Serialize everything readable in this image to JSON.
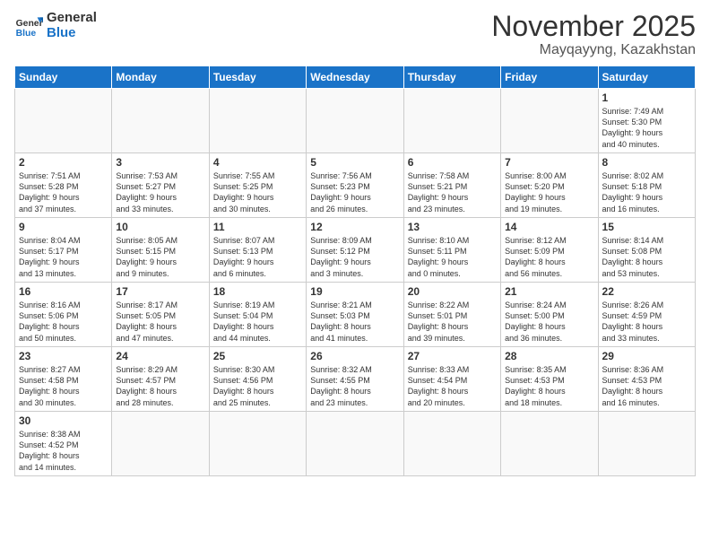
{
  "header": {
    "logo_general": "General",
    "logo_blue": "Blue",
    "title": "November 2025",
    "subtitle": "Mayqayyng, Kazakhstan"
  },
  "days_of_week": [
    "Sunday",
    "Monday",
    "Tuesday",
    "Wednesday",
    "Thursday",
    "Friday",
    "Saturday"
  ],
  "weeks": [
    [
      {
        "day": "",
        "info": ""
      },
      {
        "day": "",
        "info": ""
      },
      {
        "day": "",
        "info": ""
      },
      {
        "day": "",
        "info": ""
      },
      {
        "day": "",
        "info": ""
      },
      {
        "day": "",
        "info": ""
      },
      {
        "day": "1",
        "info": "Sunrise: 7:49 AM\nSunset: 5:30 PM\nDaylight: 9 hours\nand 40 minutes."
      }
    ],
    [
      {
        "day": "2",
        "info": "Sunrise: 7:51 AM\nSunset: 5:28 PM\nDaylight: 9 hours\nand 37 minutes."
      },
      {
        "day": "3",
        "info": "Sunrise: 7:53 AM\nSunset: 5:27 PM\nDaylight: 9 hours\nand 33 minutes."
      },
      {
        "day": "4",
        "info": "Sunrise: 7:55 AM\nSunset: 5:25 PM\nDaylight: 9 hours\nand 30 minutes."
      },
      {
        "day": "5",
        "info": "Sunrise: 7:56 AM\nSunset: 5:23 PM\nDaylight: 9 hours\nand 26 minutes."
      },
      {
        "day": "6",
        "info": "Sunrise: 7:58 AM\nSunset: 5:21 PM\nDaylight: 9 hours\nand 23 minutes."
      },
      {
        "day": "7",
        "info": "Sunrise: 8:00 AM\nSunset: 5:20 PM\nDaylight: 9 hours\nand 19 minutes."
      },
      {
        "day": "8",
        "info": "Sunrise: 8:02 AM\nSunset: 5:18 PM\nDaylight: 9 hours\nand 16 minutes."
      }
    ],
    [
      {
        "day": "9",
        "info": "Sunrise: 8:04 AM\nSunset: 5:17 PM\nDaylight: 9 hours\nand 13 minutes."
      },
      {
        "day": "10",
        "info": "Sunrise: 8:05 AM\nSunset: 5:15 PM\nDaylight: 9 hours\nand 9 minutes."
      },
      {
        "day": "11",
        "info": "Sunrise: 8:07 AM\nSunset: 5:13 PM\nDaylight: 9 hours\nand 6 minutes."
      },
      {
        "day": "12",
        "info": "Sunrise: 8:09 AM\nSunset: 5:12 PM\nDaylight: 9 hours\nand 3 minutes."
      },
      {
        "day": "13",
        "info": "Sunrise: 8:10 AM\nSunset: 5:11 PM\nDaylight: 9 hours\nand 0 minutes."
      },
      {
        "day": "14",
        "info": "Sunrise: 8:12 AM\nSunset: 5:09 PM\nDaylight: 8 hours\nand 56 minutes."
      },
      {
        "day": "15",
        "info": "Sunrise: 8:14 AM\nSunset: 5:08 PM\nDaylight: 8 hours\nand 53 minutes."
      }
    ],
    [
      {
        "day": "16",
        "info": "Sunrise: 8:16 AM\nSunset: 5:06 PM\nDaylight: 8 hours\nand 50 minutes."
      },
      {
        "day": "17",
        "info": "Sunrise: 8:17 AM\nSunset: 5:05 PM\nDaylight: 8 hours\nand 47 minutes."
      },
      {
        "day": "18",
        "info": "Sunrise: 8:19 AM\nSunset: 5:04 PM\nDaylight: 8 hours\nand 44 minutes."
      },
      {
        "day": "19",
        "info": "Sunrise: 8:21 AM\nSunset: 5:03 PM\nDaylight: 8 hours\nand 41 minutes."
      },
      {
        "day": "20",
        "info": "Sunrise: 8:22 AM\nSunset: 5:01 PM\nDaylight: 8 hours\nand 39 minutes."
      },
      {
        "day": "21",
        "info": "Sunrise: 8:24 AM\nSunset: 5:00 PM\nDaylight: 8 hours\nand 36 minutes."
      },
      {
        "day": "22",
        "info": "Sunrise: 8:26 AM\nSunset: 4:59 PM\nDaylight: 8 hours\nand 33 minutes."
      }
    ],
    [
      {
        "day": "23",
        "info": "Sunrise: 8:27 AM\nSunset: 4:58 PM\nDaylight: 8 hours\nand 30 minutes."
      },
      {
        "day": "24",
        "info": "Sunrise: 8:29 AM\nSunset: 4:57 PM\nDaylight: 8 hours\nand 28 minutes."
      },
      {
        "day": "25",
        "info": "Sunrise: 8:30 AM\nSunset: 4:56 PM\nDaylight: 8 hours\nand 25 minutes."
      },
      {
        "day": "26",
        "info": "Sunrise: 8:32 AM\nSunset: 4:55 PM\nDaylight: 8 hours\nand 23 minutes."
      },
      {
        "day": "27",
        "info": "Sunrise: 8:33 AM\nSunset: 4:54 PM\nDaylight: 8 hours\nand 20 minutes."
      },
      {
        "day": "28",
        "info": "Sunrise: 8:35 AM\nSunset: 4:53 PM\nDaylight: 8 hours\nand 18 minutes."
      },
      {
        "day": "29",
        "info": "Sunrise: 8:36 AM\nSunset: 4:53 PM\nDaylight: 8 hours\nand 16 minutes."
      }
    ],
    [
      {
        "day": "30",
        "info": "Sunrise: 8:38 AM\nSunset: 4:52 PM\nDaylight: 8 hours\nand 14 minutes."
      },
      {
        "day": "",
        "info": ""
      },
      {
        "day": "",
        "info": ""
      },
      {
        "day": "",
        "info": ""
      },
      {
        "day": "",
        "info": ""
      },
      {
        "day": "",
        "info": ""
      },
      {
        "day": "",
        "info": ""
      }
    ]
  ]
}
